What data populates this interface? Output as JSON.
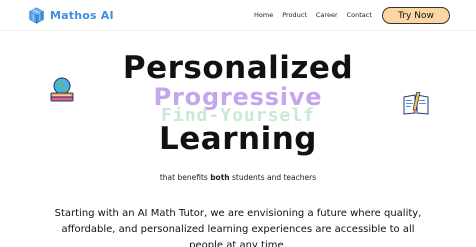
{
  "brand": {
    "name": "Mathos AI",
    "accent": "#3f8fe0"
  },
  "nav": {
    "links": [
      "Home",
      "Product",
      "Career",
      "Contact"
    ],
    "cta_label": "Try Now",
    "cta_color": "#fbd6a2"
  },
  "hero": {
    "line1": "Personalized",
    "line2": "Progressive",
    "line3": "Find-Yourself",
    "line4": "Learning",
    "line2_color": "#c4a6ec",
    "line3_color": "#c7ead4"
  },
  "subtitle": {
    "before": "that benefits ",
    "bold": "both",
    "after": " students and teachers"
  },
  "description": {
    "line1": "Starting with an AI Math Tutor, we are envisioning a future where quality,",
    "line2": "affordable, and personalized learning experiences are accessible to all",
    "line3": "people at any time."
  },
  "icons": {
    "logo": "cube-logo-icon",
    "left_decoration": "globe-book-icon",
    "right_decoration": "open-book-pencil-icon"
  }
}
